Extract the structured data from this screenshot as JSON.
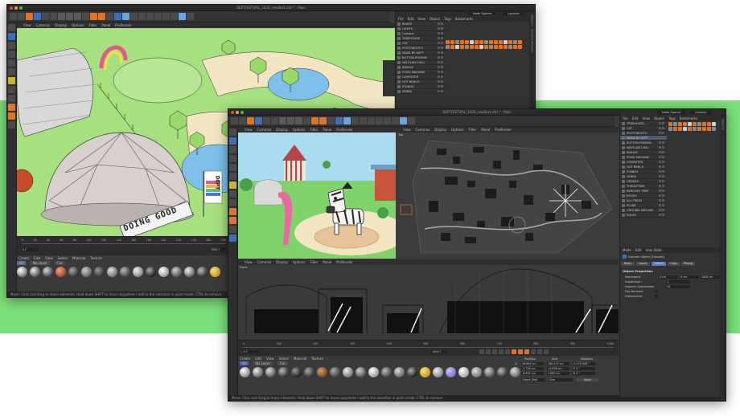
{
  "colors": {
    "accent_orange": "#d9762b",
    "selection_blue": "#4a5a78",
    "backdrop_green": "#7be07a"
  },
  "back_window": {
    "title": "DEPTFESTIVAL_2020_newRect.c4d * - Main",
    "node_spaces_label": "Node Spaces",
    "layouts_label": "Layouts",
    "viewport_menu": [
      "View",
      "Cameras",
      "Display",
      "Options",
      "Filter",
      "Panel",
      "ProRender"
    ],
    "object_menu": [
      "File",
      "Edit",
      "View",
      "Object",
      "Tags",
      "Bookmarks"
    ],
    "objects": [
      "BEARS",
      "LIGHTS",
      "Camera",
      "TREEHOUSE",
      "CAT",
      "PHOTOBOOTH",
      "MADE BY DEPT",
      "BUTTON PODIUM",
      "NEUTLAB CHILL",
      "RADIOS",
      "PONG MACHINE",
      "COMPUTER",
      "HOT BENCH",
      "STANDS",
      "ZEBRA"
    ],
    "sign_text": "DOING GOOD",
    "flag_text": "DEPT",
    "timeline_ticks": [
      "0",
      "20",
      "40",
      "60",
      "80",
      "100",
      "120",
      "140",
      "160",
      "180",
      "200",
      "220",
      "240",
      "260",
      "280"
    ],
    "frame_field": "0 F",
    "end_frame": "1000 F",
    "material_menu": [
      "Create",
      "Edit",
      "View",
      "Select",
      "Material",
      "Texture"
    ],
    "material_filters": [
      "All",
      "No Layer",
      "Car"
    ],
    "status": "Move: Click and drag to move elements. Hold down SHIFT to move anywhere / add to the selection in point mode, CTRL to remove."
  },
  "front_window": {
    "title": "DEPTFESTIVAL_2020_newRect.c4d * - Main",
    "node_spaces_label": "Node Spaces",
    "layouts_label": "Layouts",
    "viewport_menu": [
      "View",
      "Cameras",
      "Display",
      "Options",
      "Filter",
      "Panel",
      "ProRender"
    ],
    "viewport_persp_label": "Perspective",
    "viewport_top_label": "Top",
    "viewport_front_label": "Front",
    "object_menu": [
      "File",
      "Edit",
      "View",
      "Object",
      "Tags",
      "Bookmarks"
    ],
    "objects": [
      "TREEHOUSE",
      "CAT",
      "PHOTOBOOTH",
      "MADE BY DEPT",
      "BUTTON PODIUM",
      "NEUTLAB CHILL",
      "RADIOS",
      "PONG MACHINE",
      "COMPUTER",
      "HOT BENCH",
      "STANDS",
      "ZEBRA",
      "HEDGES",
      "THINGYTREE",
      "BENCHES TREE",
      "ROCKS",
      "ALL TREES",
      "PLANE",
      "GROUND ARROWS",
      "RULES"
    ],
    "selected_object": "MADE BY DEPT",
    "attr_menu": [
      "Mode",
      "Edit",
      "User Data"
    ],
    "attr_object_name": "Extrude Object [Extrude]",
    "attr_tabs": [
      "Basic",
      "Coord.",
      "Object",
      "Caps",
      "Phong"
    ],
    "attr_active_tab": "Object",
    "object_properties_label": "Object Properties",
    "properties": [
      {
        "label": "Movement",
        "value": "0 cm",
        "value2": "0 cm",
        "value3": "1000 cm"
      },
      {
        "label": "Subdivision",
        "value": "1"
      },
      {
        "label": "Isoparm Subdivision",
        "value": "10"
      },
      {
        "label": "Flip Normals",
        "value": ""
      },
      {
        "label": "Hierarchical",
        "value": ""
      }
    ],
    "timeline_ticks": [
      "0",
      "100",
      "200",
      "300",
      "400",
      "500",
      "600",
      "700",
      "800",
      "900",
      "1000"
    ],
    "frame_field": "0 F",
    "end_frame": "1000 F",
    "material_menu": [
      "Create",
      "Edit",
      "View",
      "Select",
      "Material",
      "Texture"
    ],
    "material_filters": [
      "All",
      "No Layer",
      "Car"
    ],
    "coord_headers": [
      "Position",
      "Size",
      "Rotation"
    ],
    "coord_rows": [
      {
        "axis": "X",
        "pos": "28.694 cm",
        "size": "190.073 cm",
        "rot": "H 270.048 °"
      },
      {
        "axis": "Y",
        "pos": "-2.778 cm",
        "size": "14.638 cm",
        "rot": "P 0 °"
      },
      {
        "axis": "Z",
        "pos": "-6.835 cm",
        "size": "1.889 cm",
        "rot": "B 0 °"
      }
    ],
    "coord_mode": "Object (Rel)",
    "coord_size_mode": "Size",
    "apply_label": "Apply",
    "status": "Move: Click and drag to move elements. Hold down SHIFT to move anywhere / add to the selection in point mode, CTRL to remove."
  }
}
